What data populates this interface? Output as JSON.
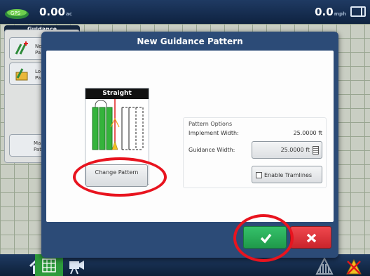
{
  "topbar": {
    "speed_left_value": "0.00",
    "speed_left_unit": "ac",
    "speed_right_value": "0.0",
    "speed_right_unit": "mph"
  },
  "panel": {
    "tab_label": "Guidance",
    "buttons": [
      {
        "label": "New\nPattern",
        "icon": "new-pattern-icon"
      },
      {
        "label": "Load\nPattern",
        "icon": "load-pattern-icon"
      },
      {
        "label": "Manage\nPatterns",
        "icon": ""
      }
    ]
  },
  "dialog": {
    "title": "New Guidance Pattern",
    "pattern_name": "Straight",
    "change_pattern_label": "Change Pattern",
    "options_title": "Pattern Options",
    "implement_width_label": "Implement Width:",
    "implement_width_value": "25.0000 ft",
    "guidance_width_label": "Guidance Width:",
    "guidance_width_value": "25.0000 ft",
    "tramlines_label": "Enable Tramlines",
    "tramlines_checked": false
  },
  "colors": {
    "accent": "#2c4b77",
    "ok": "#2bb35c",
    "cancel": "#e0363c",
    "highlight_ring": "#e8141f"
  },
  "bottombar": {
    "icons": [
      "home-icon",
      "grid-icon",
      "camera-icon",
      "field-icon",
      "warning-icon"
    ]
  }
}
